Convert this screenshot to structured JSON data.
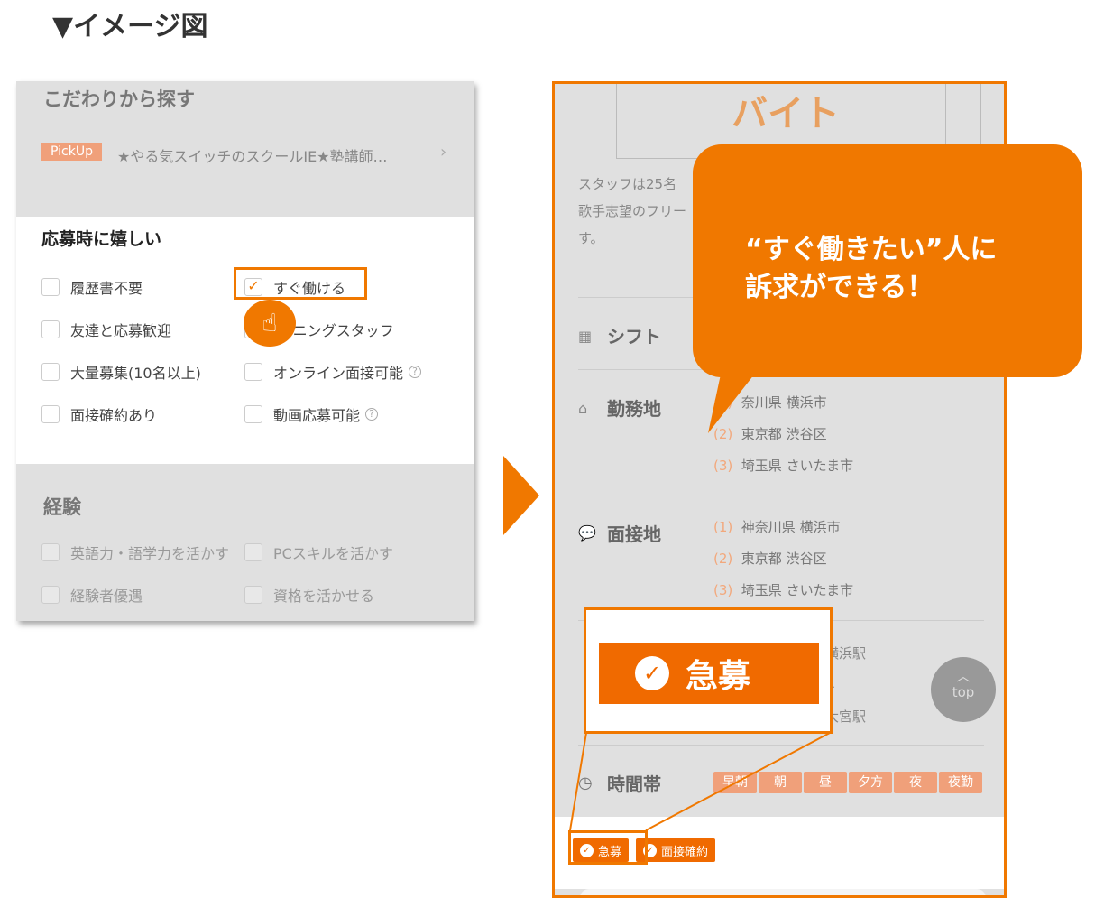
{
  "heading": "▼イメージ図",
  "left": {
    "section_title": "こだわりから探す",
    "pickup_badge": "PickUp",
    "pickup_text": "★やる気スイッチのスクールIE★塾講師…",
    "pickup_chevron": "›",
    "group1_title": "応募時に嬉しい",
    "group1": [
      {
        "label": "履歴書不要",
        "checked": false
      },
      {
        "label": "すぐ働ける",
        "checked": true
      },
      {
        "label": "友達と応募歓迎",
        "checked": false
      },
      {
        "label": "-プニングスタッフ",
        "checked": false
      },
      {
        "label": "大量募集(10名以上)",
        "checked": false
      },
      {
        "label": "オンライン面接可能",
        "checked": false,
        "help": "?"
      },
      {
        "label": "面接確約あり",
        "checked": false
      },
      {
        "label": "動画応募可能",
        "checked": false,
        "help": "?"
      }
    ],
    "group2_title": "経験",
    "group2": [
      {
        "label": "英語力・語学力を活かす",
        "checked": false
      },
      {
        "label": "PCスキルを活かす",
        "checked": false
      },
      {
        "label": "経験者優遇",
        "checked": false
      },
      {
        "label": "資格を活かせる",
        "checked": false
      }
    ]
  },
  "right": {
    "banner_text": "バイト",
    "desc": [
      "スタッフは25名",
      "歌手志望のフリー",
      "す。"
    ],
    "shift": "シフト",
    "workplace": {
      "title": "勤務地",
      "items": [
        {
          "n": "(1)",
          "t": "奈川県 横浜市"
        },
        {
          "n": "(2)",
          "t": "東京都 渋谷区"
        },
        {
          "n": "(3)",
          "t": "埼玉県 さいたま市"
        }
      ]
    },
    "interview": {
      "title": "面接地",
      "items": [
        {
          "n": "(1)",
          "t": "神奈川県 横浜市"
        },
        {
          "n": "(2)",
          "t": "東京都 渋谷区"
        },
        {
          "n": "(3)",
          "t": "埼玉県 さいたま市"
        }
      ]
    },
    "stations": [
      "横浜駅",
      "R",
      "大宮駅"
    ],
    "timeslot": {
      "title": "時間帯",
      "tags": [
        "早朝",
        "朝",
        "昼",
        "夕方",
        "夜",
        "夜勤"
      ]
    },
    "badges": [
      "急募",
      "面接確約"
    ],
    "top_button": "top"
  },
  "callout": {
    "line1": "“すぐ働きたい”人に",
    "line2": "訴求ができる！"
  },
  "zoom_badge": "急募",
  "colors": {
    "accent": "#f07800",
    "badge": "#f06a00"
  }
}
